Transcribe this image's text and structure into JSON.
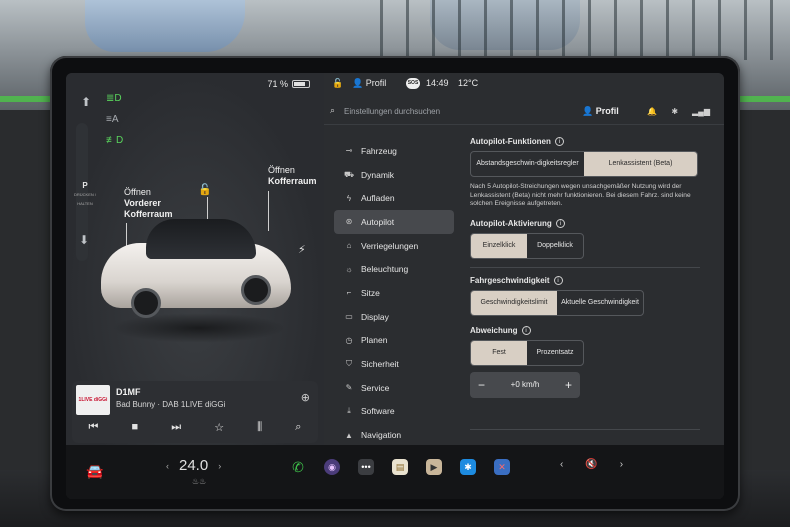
{
  "status": {
    "battery": "71 %"
  },
  "left": {
    "labels": {
      "frunk_line1": "Öffnen",
      "frunk_line2": "Vorderer",
      "frunk_line3": "Kofferraum",
      "trunk_line1": "Öffnen",
      "trunk_line2": "Kofferraum"
    },
    "gear": {
      "letter": "P",
      "sub": "DRÜCKEN / HALTEN"
    },
    "icons": [
      "headlight-icon",
      "auto-high-beam-icon",
      "fog-light-icon"
    ]
  },
  "media": {
    "art_text": "1LIVE diGGi",
    "station": "D1MF",
    "track": "Bad Bunny · DAB 1LIVE diGGi"
  },
  "topbar": {
    "profile": "Profil",
    "sos": "SOS",
    "time": "14:49",
    "temp": "12°C"
  },
  "search": {
    "placeholder": "Einstellungen durchsuchen",
    "profile": "Profil"
  },
  "nav": [
    {
      "label": "Fahrzeug",
      "icon": "toggle-icon"
    },
    {
      "label": "Dynamik",
      "icon": "car-icon"
    },
    {
      "label": "Aufladen",
      "icon": "bolt-icon"
    },
    {
      "label": "Autopilot",
      "icon": "steering-wheel-icon",
      "active": true
    },
    {
      "label": "Verriegelungen",
      "icon": "lock-icon"
    },
    {
      "label": "Beleuchtung",
      "icon": "sun-icon"
    },
    {
      "label": "Sitze",
      "icon": "seat-icon"
    },
    {
      "label": "Display",
      "icon": "display-icon"
    },
    {
      "label": "Planen",
      "icon": "clock-icon"
    },
    {
      "label": "Sicherheit",
      "icon": "shield-icon"
    },
    {
      "label": "Service",
      "icon": "wrench-icon"
    },
    {
      "label": "Software",
      "icon": "download-icon"
    },
    {
      "label": "Navigation",
      "icon": "navigation-icon"
    }
  ],
  "autopilot": {
    "features_title": "Autopilot-Funktionen",
    "features_opt1": "Abstandsgeschwin-digkeitsregler",
    "features_opt2": "Lenkassistent (Beta)",
    "features_desc": "Nach 5 Autopilot-Streichungen wegen unsachgemäßer Nutzung wird der Lenkassistent (Beta) nicht mehr funktionieren. Bei diesem Fahrz. sind keine solchen Ereignisse aufgetreten.",
    "activation_title": "Autopilot-Aktivierung",
    "activation_opt1": "Einzelklick",
    "activation_opt2": "Doppelklick",
    "speed_title": "Fahrgeschwindigkeit",
    "speed_opt1": "Geschwindigkeitslimit",
    "speed_opt2": "Aktuelle Geschwindigkeit",
    "offset_title": "Abweichung",
    "offset_opt1": "Fest",
    "offset_opt2": "Prozentsatz",
    "offset_value": "+0 km/h"
  },
  "dock": {
    "temperature": "24.0"
  },
  "colors": {
    "accent_selected": "#d8cfc4",
    "indicator_green": "#59d45c"
  }
}
